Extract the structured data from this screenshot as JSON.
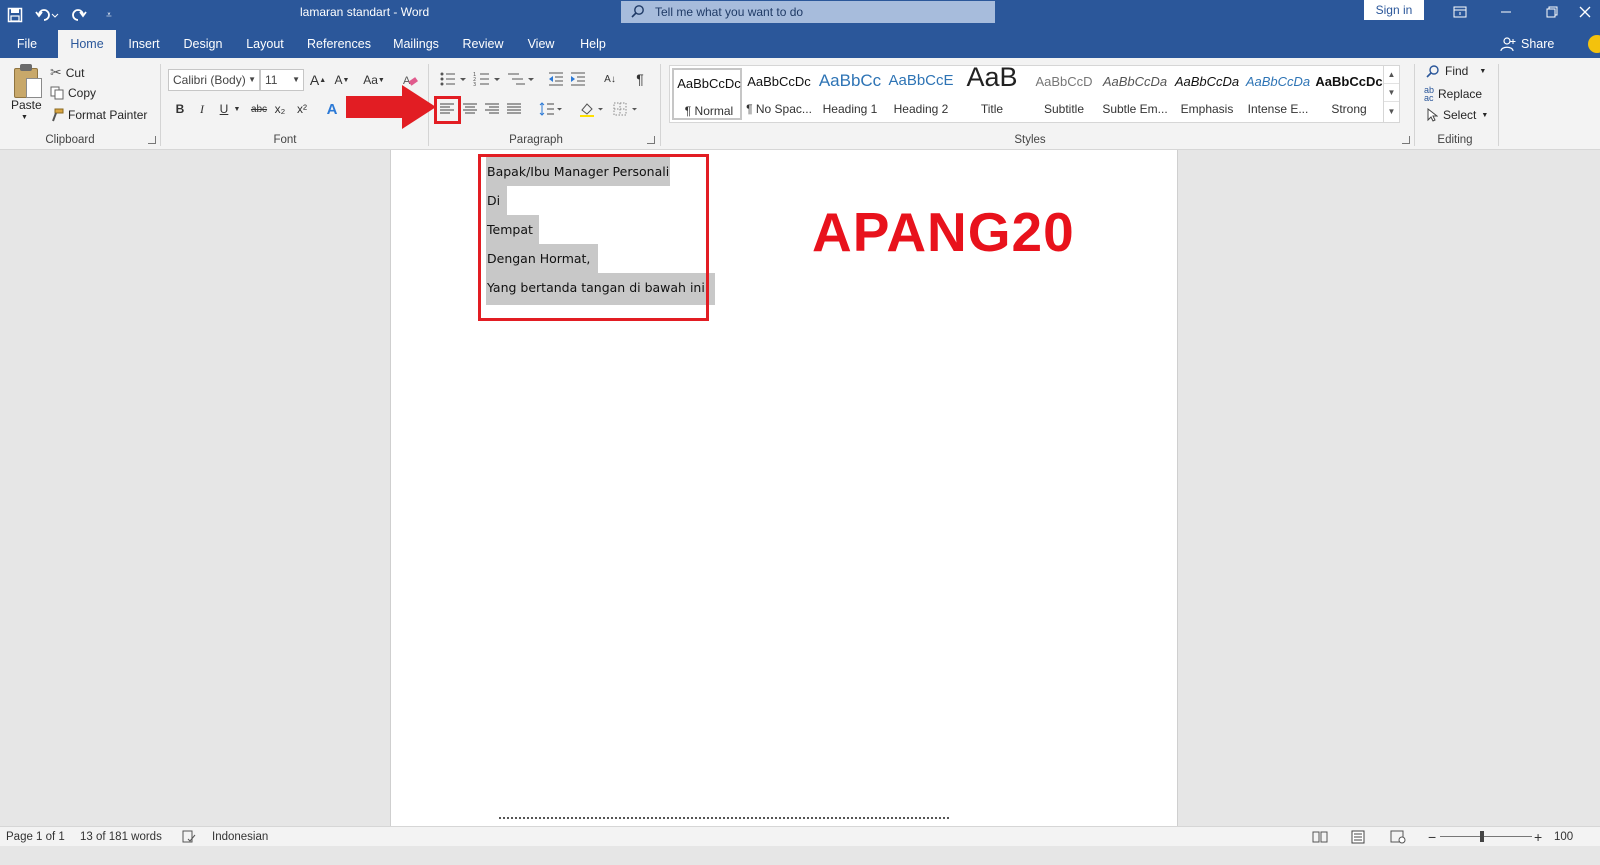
{
  "titlebar": {
    "doc_title": "lamaran standart  -  Word",
    "tell_me": "Tell me what you want to do",
    "sign_in": "Sign in",
    "qat_icons": [
      "save-icon",
      "undo-icon",
      "redo-icon",
      "customize-qat-icon"
    ],
    "window_icons": [
      "ribbon-display-icon",
      "minimize-icon",
      "restore-icon",
      "close-icon"
    ]
  },
  "tabs": [
    "File",
    "Home",
    "Insert",
    "Design",
    "Layout",
    "References",
    "Mailings",
    "Review",
    "View",
    "Help"
  ],
  "active_tab": "Home",
  "share": "Share",
  "clipboard": {
    "paste": "Paste",
    "cut": "Cut",
    "copy": "Copy",
    "format_painter": "Format Painter",
    "label": "Clipboard"
  },
  "font": {
    "family": "Calibri (Body)",
    "size": "11",
    "label": "Font",
    "bold": "B",
    "italic": "I",
    "underline": "U",
    "strikethrough": "abc",
    "subscript": "x₂",
    "superscript": "x²",
    "change_case": "Aa"
  },
  "paragraph": {
    "label": "Paragraph",
    "pilcrow": "¶"
  },
  "styles": {
    "label": "Styles",
    "items": [
      {
        "preview": "AaBbCcDc",
        "name": "¶ Normal"
      },
      {
        "preview": "AaBbCcDc",
        "name": "¶ No Spac..."
      },
      {
        "preview": "AaBbCc",
        "name": "Heading 1"
      },
      {
        "preview": "AaBbCcE",
        "name": "Heading 2"
      },
      {
        "preview": "AaB",
        "name": "Title"
      },
      {
        "preview": "AaBbCcD",
        "name": "Subtitle"
      },
      {
        "preview": "AaBbCcDa",
        "name": "Subtle Em..."
      },
      {
        "preview": "AaBbCcDa",
        "name": "Emphasis"
      },
      {
        "preview": "AaBbCcDa",
        "name": "Intense E..."
      },
      {
        "preview": "AaBbCcDc",
        "name": "Strong"
      }
    ]
  },
  "editing": {
    "label": "Editing",
    "find": "Find",
    "replace": "Replace",
    "select": "Select"
  },
  "document": {
    "lines": [
      "Bapak/Ibu Manager Personali",
      "Di",
      "Tempat",
      "Dengan Hormat,",
      "Yang bertanda tangan di bawah ini:"
    ],
    "watermark": "APANG20"
  },
  "status": {
    "page": "Page 1 of 1",
    "words": "13 of 181 words",
    "language": "Indonesian",
    "zoom": "100"
  },
  "colors": {
    "brand": "#2b579a",
    "annotation": "#e21d23",
    "watermark": "#e8121c",
    "selection": "#c8c8c8"
  }
}
